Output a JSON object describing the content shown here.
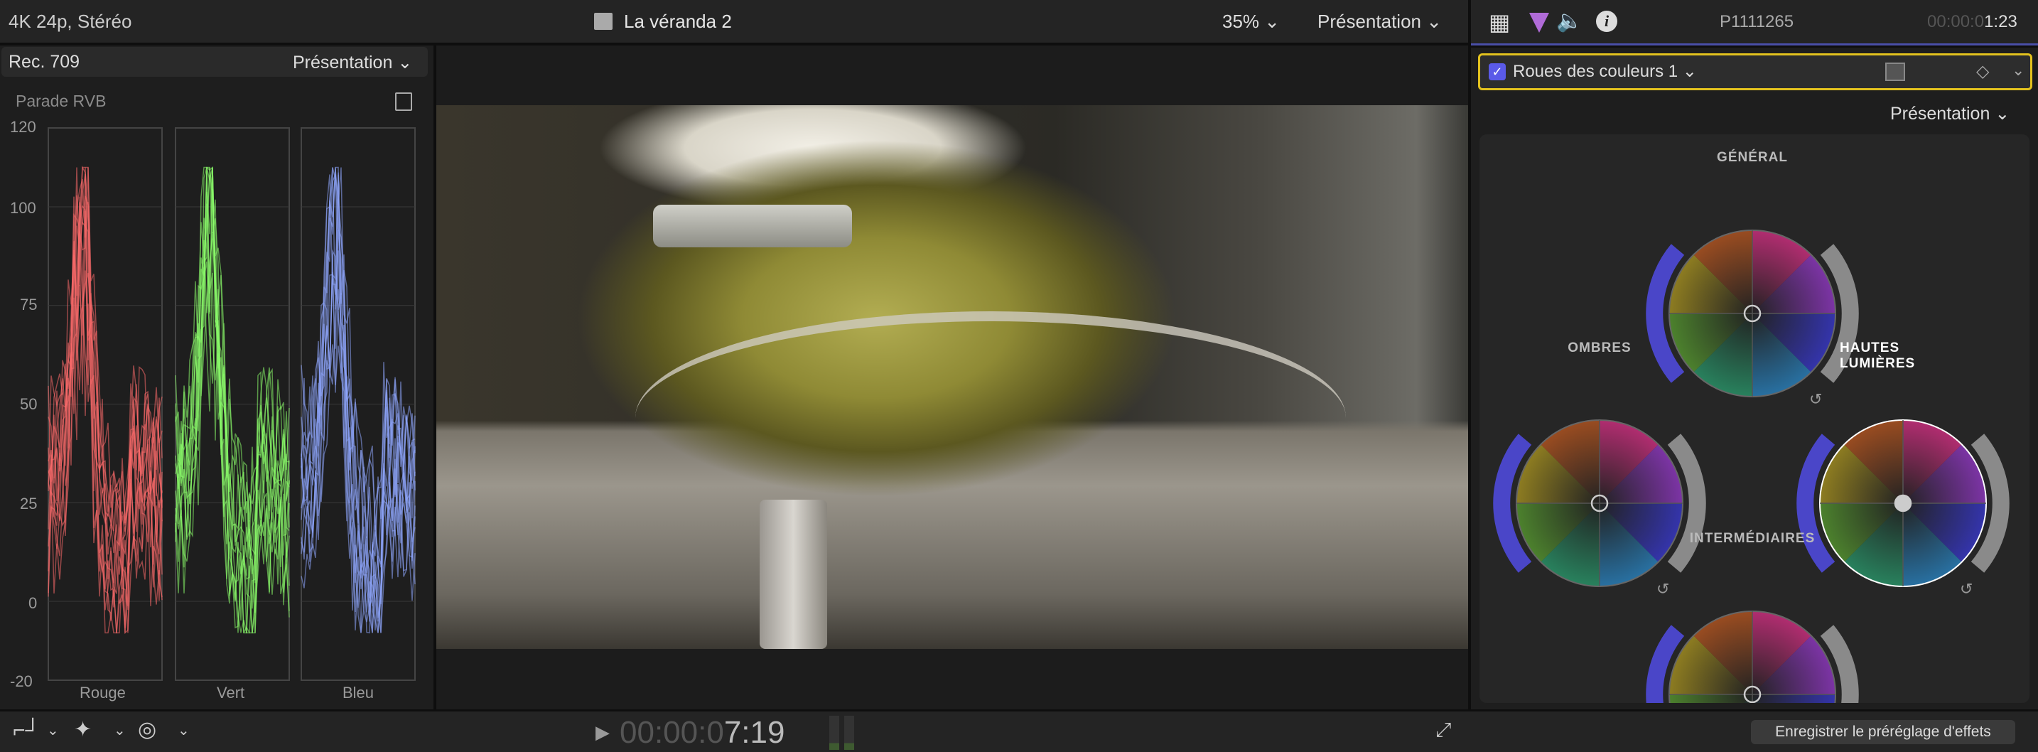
{
  "topbar": {
    "format": "4K 24p, Stéréo",
    "project": "La véranda 2",
    "zoom": "35%",
    "view_label": "Présentation"
  },
  "scopes": {
    "colorspace": "Rec. 709",
    "view_label": "Présentation",
    "title": "Parade RVB",
    "axis": [
      "120",
      "100",
      "75",
      "50",
      "25",
      "0",
      "-20"
    ],
    "channels": [
      {
        "label": "Rouge",
        "color": "#ff6b6b"
      },
      {
        "label": "Vert",
        "color": "#8dff6b"
      },
      {
        "label": "Bleu",
        "color": "#8fa8ff"
      }
    ]
  },
  "inspector": {
    "clip_name": "P1111265",
    "timecode_dim": "00:00:0",
    "timecode_bright": "1:23",
    "effect_name": "Roues des couleurs 1",
    "effect_enabled": true,
    "view_label": "Présentation",
    "wheels": [
      {
        "label": "GÉNÉRAL"
      },
      {
        "label": "OMBRES"
      },
      {
        "label": "HAUTES LUMIÈRES"
      },
      {
        "label": "INTERMÉDIAIRES"
      }
    ],
    "save_preset": "Enregistrer le préréglage d'effets"
  },
  "bottom": {
    "timecode_dim": "00:00:0",
    "timecode_bright": "7:19"
  }
}
